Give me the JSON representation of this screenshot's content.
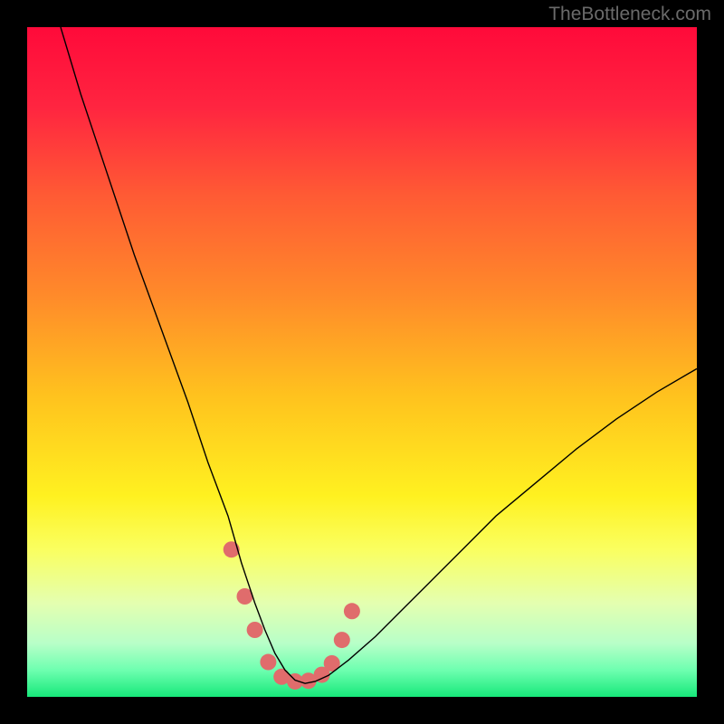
{
  "watermark": "TheBottleneck.com",
  "chart_data": {
    "type": "line",
    "title": "",
    "xlabel": "",
    "ylabel": "",
    "xlim": [
      0,
      100
    ],
    "ylim": [
      0,
      100
    ],
    "background_gradient": {
      "stops": [
        {
          "offset": 0.0,
          "color": "#ff0a3a"
        },
        {
          "offset": 0.12,
          "color": "#ff2540"
        },
        {
          "offset": 0.25,
          "color": "#ff5a34"
        },
        {
          "offset": 0.4,
          "color": "#ff8a2a"
        },
        {
          "offset": 0.55,
          "color": "#ffc21e"
        },
        {
          "offset": 0.7,
          "color": "#fff120"
        },
        {
          "offset": 0.78,
          "color": "#faff60"
        },
        {
          "offset": 0.86,
          "color": "#e4ffb0"
        },
        {
          "offset": 0.92,
          "color": "#b8ffc8"
        },
        {
          "offset": 0.96,
          "color": "#6effb0"
        },
        {
          "offset": 1.0,
          "color": "#17e87a"
        }
      ]
    },
    "series": [
      {
        "name": "bottleneck-curve",
        "stroke": "#000000",
        "stroke_width": 1.4,
        "x": [
          5,
          8,
          12,
          16,
          20,
          24,
          27,
          30,
          32,
          34,
          35.5,
          37,
          38.5,
          40,
          41.5,
          43,
          45,
          48,
          52,
          56,
          60,
          65,
          70,
          76,
          82,
          88,
          94,
          100
        ],
        "y": [
          100,
          90,
          78,
          66,
          55,
          44,
          35,
          27,
          20,
          14,
          10,
          6.5,
          4,
          2.5,
          2,
          2.3,
          3.2,
          5.5,
          9,
          13,
          17,
          22,
          27,
          32,
          37,
          41.5,
          45.5,
          49
        ]
      }
    ],
    "markers": {
      "name": "highlight-points",
      "fill": "#e06c6c",
      "radius_px": 9,
      "x": [
        30.5,
        32.5,
        34,
        36,
        38,
        40,
        42,
        44,
        45.5,
        47,
        48.5
      ],
      "y": [
        22,
        15,
        10,
        5.2,
        3.0,
        2.3,
        2.4,
        3.3,
        5.0,
        8.5,
        12.8
      ]
    }
  }
}
